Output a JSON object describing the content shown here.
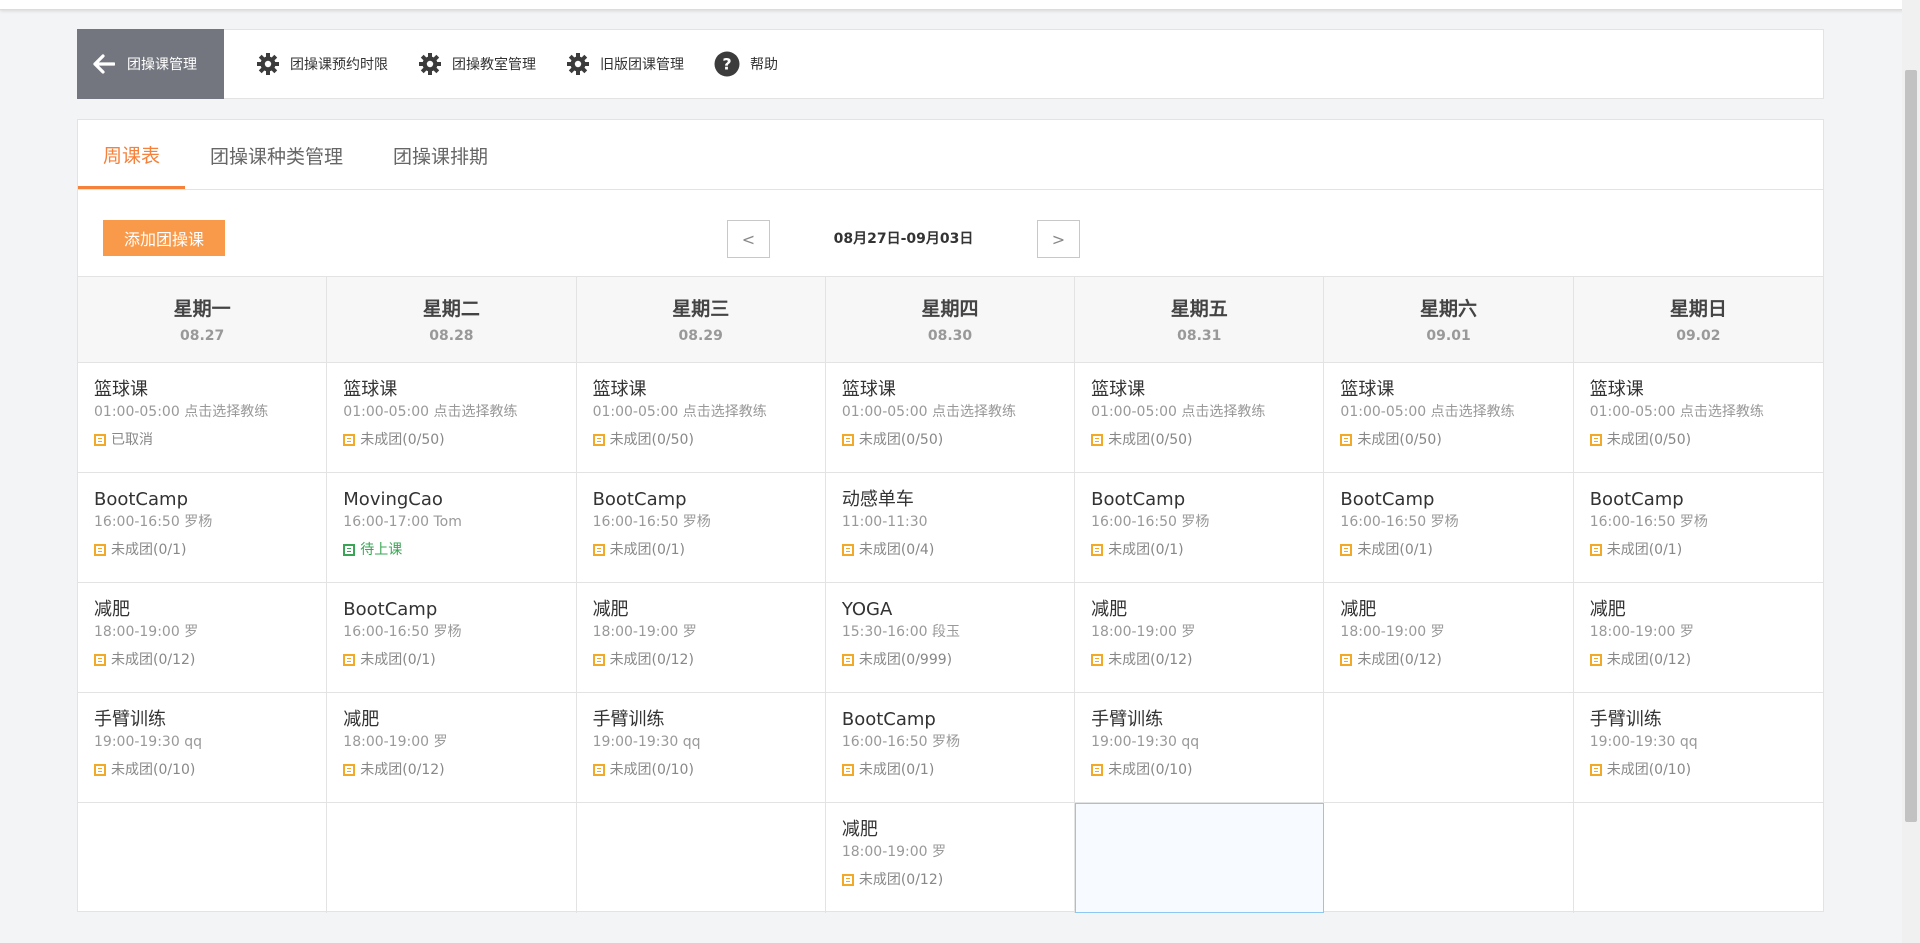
{
  "toolbar": {
    "back_label": "团操课管理",
    "items": [
      {
        "label": "团操课预约时限",
        "icon": "gear-icon"
      },
      {
        "label": "团操教室管理",
        "icon": "gear-icon"
      },
      {
        "label": "旧版团课管理",
        "icon": "gear-icon"
      },
      {
        "label": "帮助",
        "icon": "help-icon"
      }
    ]
  },
  "tabs": [
    {
      "label": "周课表",
      "active": true
    },
    {
      "label": "团操课种类管理",
      "active": false
    },
    {
      "label": "团操课排期",
      "active": false
    }
  ],
  "controls": {
    "add_label": "添加团操课",
    "prev_label": "<",
    "next_label": ">",
    "date_range": "08月27日-09月03日"
  },
  "days": [
    {
      "day": "星期一",
      "date": "08.27"
    },
    {
      "day": "星期二",
      "date": "08.28"
    },
    {
      "day": "星期三",
      "date": "08.29"
    },
    {
      "day": "星期四",
      "date": "08.30"
    },
    {
      "day": "星期五",
      "date": "08.31"
    },
    {
      "day": "星期六",
      "date": "09.01"
    },
    {
      "day": "星期日",
      "date": "09.02"
    }
  ],
  "rows": [
    [
      {
        "name": "篮球课",
        "time": "01:00-05:00 点击选择教练",
        "status": "已取消",
        "status_color": "#f2a928"
      },
      {
        "name": "篮球课",
        "time": "01:00-05:00 点击选择教练",
        "status": "未成团(0/50)",
        "status_color": "#f2a928"
      },
      {
        "name": "篮球课",
        "time": "01:00-05:00 点击选择教练",
        "status": "未成团(0/50)",
        "status_color": "#f2a928"
      },
      {
        "name": "篮球课",
        "time": "01:00-05:00 点击选择教练",
        "status": "未成团(0/50)",
        "status_color": "#f2a928"
      },
      {
        "name": "篮球课",
        "time": "01:00-05:00 点击选择教练",
        "status": "未成团(0/50)",
        "status_color": "#f2a928"
      },
      {
        "name": "篮球课",
        "time": "01:00-05:00 点击选择教练",
        "status": "未成团(0/50)",
        "status_color": "#f2a928"
      },
      {
        "name": "篮球课",
        "time": "01:00-05:00 点击选择教练",
        "status": "未成团(0/50)",
        "status_color": "#f2a928"
      }
    ],
    [
      {
        "name": "BootCamp",
        "time": "16:00-16:50 罗杨",
        "status": "未成团(0/1)",
        "status_color": "#f2a928"
      },
      {
        "name": "MovingCao",
        "time": "16:00-17:00 Tom",
        "status": "待上课",
        "status_color": "#3aa655"
      },
      {
        "name": "BootCamp",
        "time": "16:00-16:50 罗杨",
        "status": "未成团(0/1)",
        "status_color": "#f2a928"
      },
      {
        "name": "动感单车",
        "time": "11:00-11:30",
        "status": "未成团(0/4)",
        "status_color": "#f2a928"
      },
      {
        "name": "BootCamp",
        "time": "16:00-16:50 罗杨",
        "status": "未成团(0/1)",
        "status_color": "#f2a928"
      },
      {
        "name": "BootCamp",
        "time": "16:00-16:50 罗杨",
        "status": "未成团(0/1)",
        "status_color": "#f2a928"
      },
      {
        "name": "BootCamp",
        "time": "16:00-16:50 罗杨",
        "status": "未成团(0/1)",
        "status_color": "#f2a928"
      }
    ],
    [
      {
        "name": "减肥",
        "time": "18:00-19:00 罗",
        "status": "未成团(0/12)",
        "status_color": "#f2a928"
      },
      {
        "name": "BootCamp",
        "time": "16:00-16:50 罗杨",
        "status": "未成团(0/1)",
        "status_color": "#f2a928"
      },
      {
        "name": "减肥",
        "time": "18:00-19:00 罗",
        "status": "未成团(0/12)",
        "status_color": "#f2a928"
      },
      {
        "name": "YOGA",
        "time": "15:30-16:00 段玉",
        "status": "未成团(0/999)",
        "status_color": "#f2a928"
      },
      {
        "name": "减肥",
        "time": "18:00-19:00 罗",
        "status": "未成团(0/12)",
        "status_color": "#f2a928"
      },
      {
        "name": "减肥",
        "time": "18:00-19:00 罗",
        "status": "未成团(0/12)",
        "status_color": "#f2a928"
      },
      {
        "name": "减肥",
        "time": "18:00-19:00 罗",
        "status": "未成团(0/12)",
        "status_color": "#f2a928"
      }
    ],
    [
      {
        "name": "手臂训练",
        "time": "19:00-19:30 qq",
        "status": "未成团(0/10)",
        "status_color": "#f2a928"
      },
      {
        "name": "减肥",
        "time": "18:00-19:00 罗",
        "status": "未成团(0/12)",
        "status_color": "#f2a928"
      },
      {
        "name": "手臂训练",
        "time": "19:00-19:30 qq",
        "status": "未成团(0/10)",
        "status_color": "#f2a928"
      },
      {
        "name": "BootCamp",
        "time": "16:00-16:50 罗杨",
        "status": "未成团(0/1)",
        "status_color": "#f2a928"
      },
      {
        "name": "手臂训练",
        "time": "19:00-19:30 qq",
        "status": "未成团(0/10)",
        "status_color": "#f2a928"
      },
      null,
      {
        "name": "手臂训练",
        "time": "19:00-19:30 qq",
        "status": "未成团(0/10)",
        "status_color": "#f2a928"
      }
    ],
    [
      null,
      null,
      null,
      {
        "name": "减肥",
        "time": "18:00-19:00 罗",
        "status": "未成团(0/12)",
        "status_color": "#f2a928"
      },
      null,
      null,
      null
    ]
  ],
  "colors": {
    "accent": "#f5813a",
    "add_button": "#f99a4b",
    "back_button": "#73767e",
    "status_pending": "#f2a928",
    "status_ready": "#3aa655"
  }
}
